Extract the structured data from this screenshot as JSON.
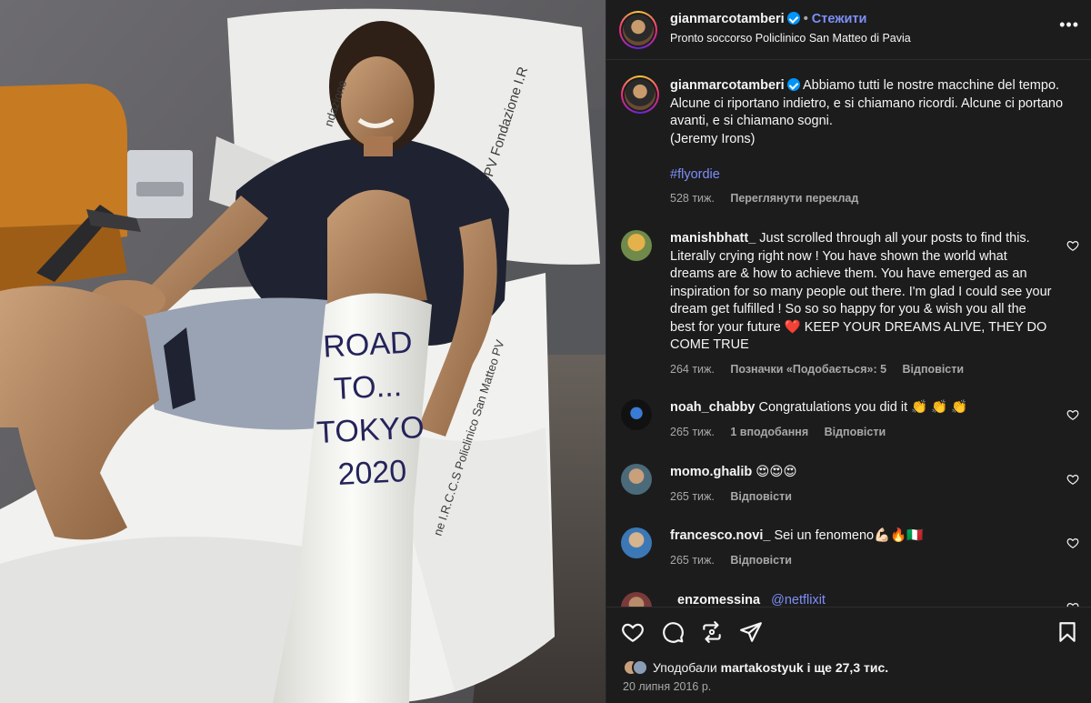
{
  "photo": {
    "cast_lines": [
      "ROAD",
      "TO...",
      "TOKYO",
      "2020"
    ],
    "pillow_text": "-PV  Fondazione I.R",
    "pillow_text2": "ndazione",
    "sheet_text": "ne I.R.C.C.S Policlinico San Matteo PV"
  },
  "header": {
    "username": "gianmarcotamberi",
    "dot": "•",
    "follow_label": "Стежити",
    "location": "Pronto soccorso Policlinico San Matteo di Pavia",
    "more": "•••"
  },
  "caption": {
    "username": "gianmarcotamberi",
    "text": "Abbiamo tutti le nostre macchine del tempo. Alcune ci riportano indietro, e si chiamano ricordi. Alcune ci portano avanti, e si chiamano sogni.",
    "quote": "(Jeremy Irons)",
    "hashtag": "#flyordie",
    "time": "528 тиж.",
    "translate": "Переглянути переклад"
  },
  "comments": [
    {
      "username": "manishbhatt_",
      "text": "Just scrolled through all your posts to find this. Literally crying right now ! You have shown the world what dreams are & how to achieve them. You have emerged as an inspiration for so many people out there. I'm glad I could see your dream get fulfilled ! So so so happy for you & wish you all the best for your future ❤️ KEEP YOUR DREAMS ALIVE, THEY DO COME TRUE",
      "time": "264 тиж.",
      "likes": "Позначки «Подобається»: 5",
      "reply": "Відповісти"
    },
    {
      "username": "noah_chabby",
      "text": "Congratulations you did it 👏 👏 👏",
      "time": "265 тиж.",
      "likes": "1 вподобання",
      "reply": "Відповісти"
    },
    {
      "username": "momo.ghalib",
      "text": "😍😍😍",
      "time": "265 тиж.",
      "reply": "Відповісти"
    },
    {
      "username": "francesco.novi_",
      "text": "Sei un fenomeno💪🏻🔥🇮🇹",
      "time": "265 тиж.",
      "reply": "Відповісти"
    },
    {
      "username": "enzomessina",
      "text": "@netflixit"
    }
  ],
  "footer": {
    "likes_prefix": "Уподобали",
    "likes_user": "martakostyuk",
    "likes_suffix": "і ще 27,3 тис.",
    "date": "20 липня 2016 р."
  },
  "icons": [
    "heart-icon",
    "comment-icon",
    "share-icon",
    "send-icon",
    "bookmark-icon",
    "verified-badge-icon",
    "more-options-icon"
  ],
  "colors": {
    "panel_bg": "#1c1c1d",
    "link": "#7d8ff7",
    "muted": "#a8a8a8",
    "verified": "#0095f6"
  }
}
